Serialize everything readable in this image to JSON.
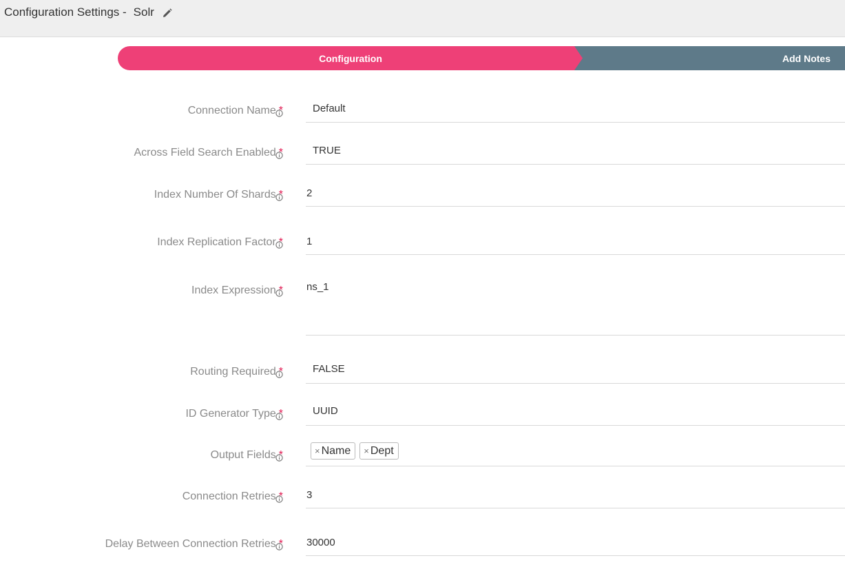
{
  "header": {
    "title": "Configuration Settings -",
    "entity_name": "Solr",
    "edit_icon": "pencil-icon"
  },
  "stepper": {
    "steps": [
      {
        "label": "Configuration",
        "state": "active",
        "color": "#ee4077"
      },
      {
        "label": "Add Notes",
        "state": "inactive",
        "color": "#5e7a89"
      }
    ]
  },
  "form": {
    "required_marker": "*",
    "info_icon": "info-circle-icon",
    "fields": [
      {
        "label": "Connection Name",
        "value": "Default"
      },
      {
        "label": "Across Field Search Enabled",
        "value": "TRUE"
      },
      {
        "label": "Index Number Of Shards",
        "value": "2"
      },
      {
        "label": "Index Replication Factor",
        "value": "1"
      },
      {
        "label": "Index Expression",
        "value": "ns_1"
      },
      {
        "label": "Routing Required",
        "value": "FALSE"
      },
      {
        "label": "ID Generator Type",
        "value": "UUID"
      },
      {
        "label": "Output Fields",
        "tags": [
          "Name",
          "Dept"
        ],
        "remove_glyph": "×"
      },
      {
        "label": "Connection Retries",
        "value": "3"
      },
      {
        "label": "Delay Between Connection Retries",
        "value": "30000"
      }
    ]
  }
}
